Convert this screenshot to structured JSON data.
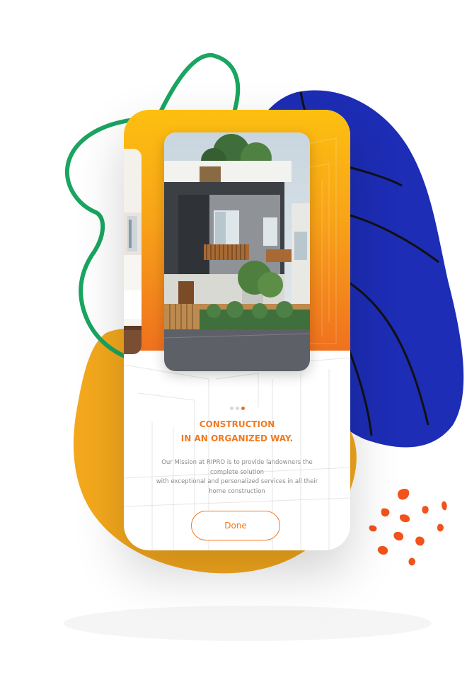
{
  "onboarding": {
    "title_line1": "CONSTRUCTION",
    "title_line2": "IN AN ORGANIZED WAY.",
    "description_line1": "Our Mission at RIPRO is to provide landowners the",
    "description_line2": "complete solution",
    "description_line3": "with exceptional and personalized services in all their",
    "description_line4": "home construction",
    "done_label": "Done",
    "pagination": {
      "total": 3,
      "active_index": 2
    }
  },
  "colors": {
    "accent_orange": "#f07a22",
    "gradient_top": "#fdbf10",
    "gradient_bottom": "#f0711e",
    "blob_blue": "#1d2db5",
    "blob_yellow": "#f4a81d",
    "blob_green": "#1aa560",
    "splash_red": "#f2521b"
  },
  "icons": [
    "decorative-blob",
    "paint-splash"
  ]
}
